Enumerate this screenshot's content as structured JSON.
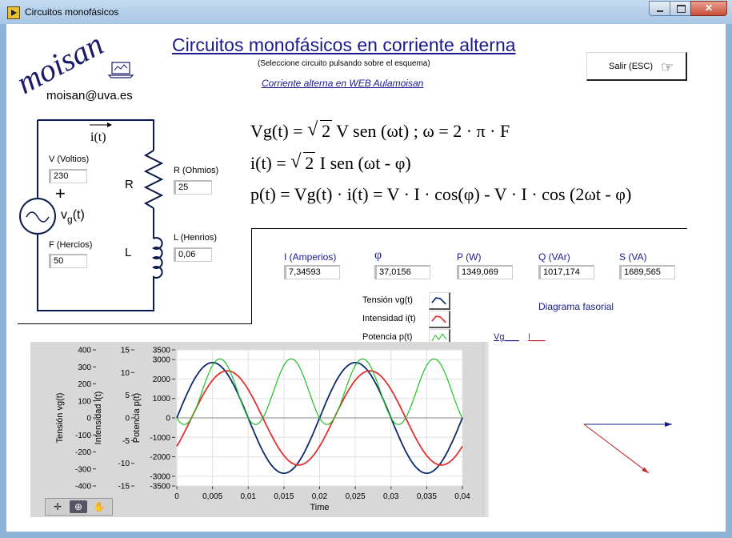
{
  "window": {
    "title": "Circuitos monofásicos"
  },
  "header": {
    "title": "Circuitos monofásicos en corriente alterna",
    "hint": "(Seleccione circuito pulsando sobre el esquema)",
    "link": "Corriente alterna en WEB Aulamoisan",
    "logo_text": "moisan",
    "email": "moisan@uva.es",
    "exit_label": "Salir (ESC)"
  },
  "circuit": {
    "current_label": "i(t)",
    "source_label": "v",
    "source_sub": "g",
    "source_suffix": "(t)",
    "plus": "+",
    "r_symbol": "R",
    "l_symbol": "L",
    "inputs": {
      "v_label": "V (Voltios)",
      "v_value": "230",
      "f_label": "F (Hercios)",
      "f_value": "50",
      "r_label": "R (Ohmios)",
      "r_value": "25",
      "l_label": "L (Henrios)",
      "l_value": "0,06"
    }
  },
  "formulas": {
    "f1_lhs": "Vg(t) =",
    "f1_rhs": "V sen (ωt) ;  ω = 2 · π · F",
    "f2_lhs": "i(t) =",
    "f2_rhs": "I sen (ωt - φ)",
    "f3": "p(t) = Vg(t) · i(t) = V · I · cos(φ) - V · I · cos (2ωt - φ)",
    "sqrt_arg": "2"
  },
  "results": {
    "i_label": "I (Amperios)",
    "i_value": "7,34593",
    "phi_label": "φ",
    "phi_value": "37,0156",
    "p_label": "P (W)",
    "p_value": "1349,069",
    "q_label": "Q (VAr)",
    "q_value": "1017,174",
    "s_label": "S (VA)",
    "s_value": "1689,565"
  },
  "legend": {
    "items": [
      "Tensión vg(t)",
      "Intensidad i(t)",
      "Potencia p(t)"
    ],
    "colors": [
      "#0a2a6a",
      "#e03030",
      "#20c020"
    ]
  },
  "phasor": {
    "title": "Diagrama fasorial",
    "vg_label": "Vg___",
    "i_label": "I___",
    "v_color": "#1a1a8c",
    "i_color": "#c02020"
  },
  "toolbar": {
    "icons": [
      "crosshair-icon",
      "zoom-icon",
      "pan-hand-icon"
    ]
  },
  "chart_data": {
    "type": "line",
    "xlabel": "Time",
    "x_ticks": [
      "0",
      "0,005",
      "0,01",
      "0,015",
      "0,02",
      "0,025",
      "0,03",
      "0,035",
      "0,04"
    ],
    "xlim": [
      0,
      0.04
    ],
    "axes": [
      {
        "label": "Tensión vg(t)",
        "ylim": [
          -400,
          400
        ],
        "ticks": [
          "400",
          "300",
          "200",
          "100",
          "0",
          "-100",
          "-200",
          "-300",
          "-400"
        ]
      },
      {
        "label": "Intensidad i(t)",
        "ylim": [
          -15,
          15
        ],
        "ticks": [
          "15",
          "10",
          "5",
          "0",
          "-5",
          "-10",
          "-15"
        ]
      },
      {
        "label": "Potencia p(t)",
        "ylim": [
          -3500,
          3500
        ],
        "ticks": [
          "3500",
          "3000",
          "2000",
          "1000",
          "0",
          "-1000",
          "-2000",
          "-3000",
          "-3500"
        ]
      }
    ],
    "frequency_hz": 50,
    "series": [
      {
        "name": "Tensión vg(t)",
        "amplitude": 325.27,
        "phase_deg": 0,
        "axis": 0,
        "color": "#0a2a6a"
      },
      {
        "name": "Intensidad i(t)",
        "amplitude": 10.389,
        "phase_deg": -37.0156,
        "axis": 1,
        "color": "#e03030"
      },
      {
        "name": "Potencia p(t)",
        "offset": 1349.069,
        "amplitude": 1689.565,
        "axis": 2,
        "color": "#20c020"
      }
    ],
    "zero_line": true
  }
}
